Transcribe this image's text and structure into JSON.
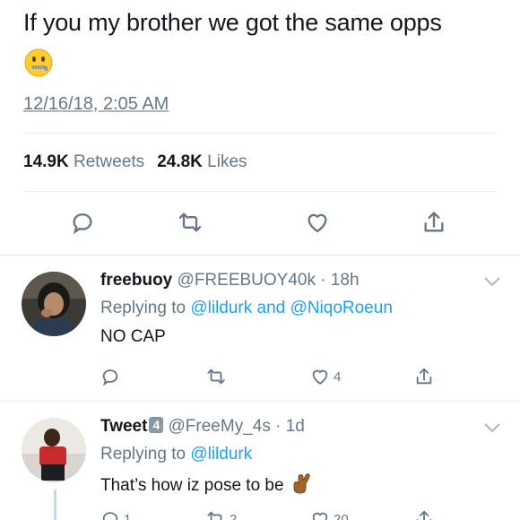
{
  "tweet": {
    "text": "If you my brother we got the same opps",
    "emoji": "zipper-mouth-face",
    "timestamp": "12/16/18, 2:05 AM",
    "retweets_count": "14.9K",
    "retweets_label": "Retweets",
    "likes_count": "24.8K",
    "likes_label": "Likes"
  },
  "actions": {
    "reply_icon": "reply-icon",
    "retweet_icon": "retweet-icon",
    "like_icon": "heart-icon",
    "share_icon": "share-icon"
  },
  "replies": [
    {
      "display_name": "freebuoy",
      "handle_time": "@FREEBUOY40k · 18h",
      "replying_label": "Replying to",
      "mention_1": "@lildurk",
      "and_label": "and",
      "mention_2": "@NiqoRoeun",
      "body": "NO CAP",
      "like_count": "4"
    },
    {
      "display_name": "Tweet",
      "badge": "4",
      "handle_time": "@FreeMy_4s · 1d",
      "replying_label": "Replying to",
      "mention_1": "@lildurk",
      "body": "That’s how iz pose to be",
      "reply_count": "1",
      "retweet_count": "2",
      "like_count": "20"
    }
  ],
  "colors": {
    "link": "#1da1f2",
    "muted": "#657786",
    "text": "#14171a",
    "divider": "#e6ecf0"
  }
}
